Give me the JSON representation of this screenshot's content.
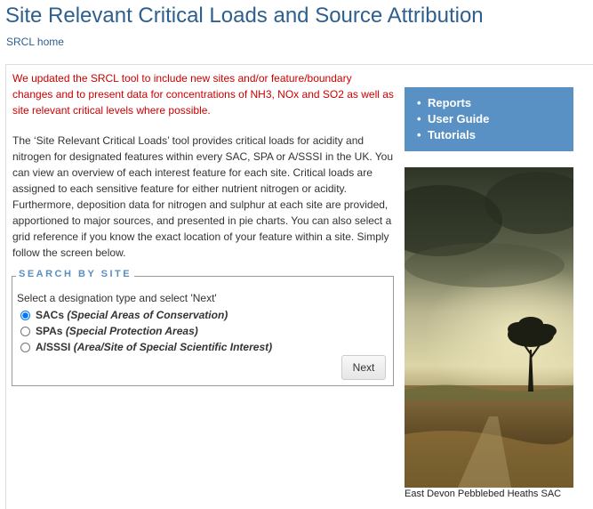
{
  "page": {
    "title": "Site Relevant Critical Loads and Source Attribution",
    "home_link": "SRCL home"
  },
  "main": {
    "notice": "We updated the SRCL tool to include new sites and/or feature/boundary changes and to present data for concentrations of NH3, NOx and SO2 as well as site relevant critical levels where possible.",
    "intro": "The ‘Site Relevant Critical Loads’ tool provides critical loads for acidity and nitrogen for designated features within every SAC, SPA or A/SSSI in the UK. You can view an overview of each interest feature for each site. Critical loads are assigned to each sensitive feature for either nutrient nitrogen or acidity. Furthermore, deposition data for nitrogen and sulphur at each site are provided, apportioned to major sources, and presented in pie charts. You can also select a grid reference if you know the exact location of your feature within a site. Simply follow the screen below."
  },
  "search": {
    "legend": "SEARCH BY SITE",
    "instructions": "Select a designation type and select 'Next'",
    "options": [
      {
        "abbr": "SACs",
        "full": "(Special Areas of Conservation)",
        "checked": true
      },
      {
        "abbr": "SPAs",
        "full": "(Special Protection Areas)",
        "checked": false
      },
      {
        "abbr": "A/SSSI",
        "full": "(Area/Site of Special Scientific Interest)",
        "checked": false
      }
    ],
    "next_label": "Next"
  },
  "sidebar": {
    "links": [
      "Reports",
      "User Guide",
      "Tutorials"
    ],
    "caption": "East Devon Pebblebed Heaths SAC"
  },
  "colors": {
    "title": "#2d5f8f",
    "notice": "#cc0000",
    "sidebar_box": "#5a91c4",
    "legend": "#5a8fc2"
  }
}
